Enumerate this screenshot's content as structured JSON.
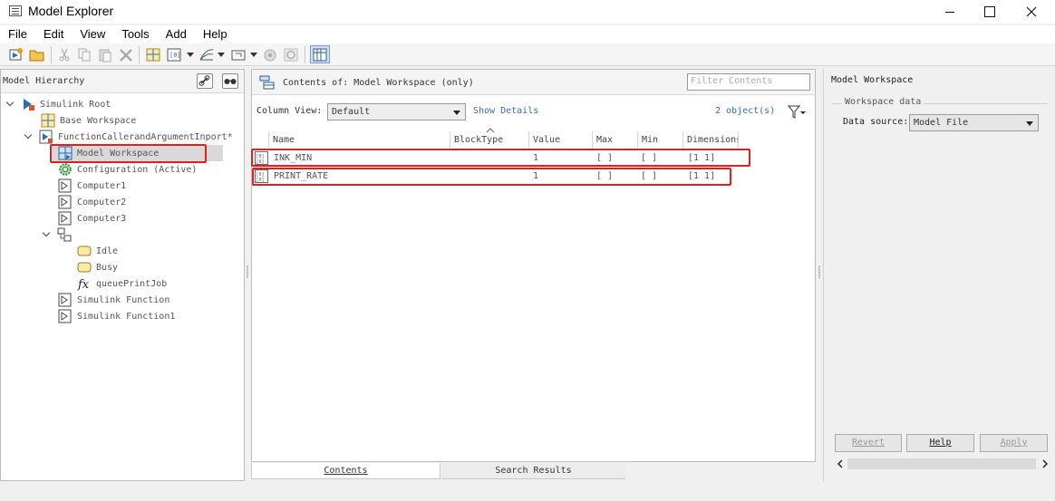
{
  "window": {
    "title": "Model Explorer"
  },
  "menu": [
    "File",
    "Edit",
    "View",
    "Tools",
    "Add",
    "Help"
  ],
  "toolbar": {
    "icons": [
      "new-model-icon",
      "open-icon",
      "cut-icon",
      "copy-icon",
      "paste-icon",
      "delete-icon",
      "grid-view-icon",
      "workspace-variable-icon",
      "signal-icon",
      "block-icon",
      "link-icon",
      "settings-icon",
      "columns-toggle-icon"
    ]
  },
  "hierarchy": {
    "title": "Model Hierarchy",
    "nodes": [
      {
        "label": "Simulink Root"
      },
      {
        "label": "Base Workspace"
      },
      {
        "label": "FunctionCallerandArgumentInport*"
      },
      {
        "label": "Model Workspace",
        "selected": true
      },
      {
        "label": "Configuration (Active)"
      },
      {
        "label": "Computer1"
      },
      {
        "label": "Computer2"
      },
      {
        "label": "Computer3"
      },
      {
        "label": ""
      },
      {
        "label": "Idle"
      },
      {
        "label": "Busy"
      },
      {
        "label": "queuePrintJob"
      },
      {
        "label": "Simulink Function"
      },
      {
        "label": "Simulink Function1"
      }
    ]
  },
  "contents": {
    "header": "Contents of: Model Workspace  (only)",
    "filter_placeholder": "Filter Contents",
    "column_view_label": "Column View:",
    "column_view_value": "Default",
    "show_details": "Show Details",
    "object_count": "2 object(s)",
    "columns": [
      "Name",
      "BlockType",
      "Value",
      "Max",
      "Min",
      "Dimensions"
    ],
    "rows": [
      {
        "name": "INK_MIN",
        "blocktype": "",
        "value": "1",
        "max": "[ ]",
        "min": "[ ]",
        "dimensions": "[1 1]"
      },
      {
        "name": "PRINT_RATE",
        "blocktype": "",
        "value": "1",
        "max": "[ ]",
        "min": "[ ]",
        "dimensions": "[1 1]"
      }
    ],
    "tabs": [
      "Contents",
      "Search Results"
    ]
  },
  "properties": {
    "title": "Model Workspace",
    "group": "Workspace data",
    "data_source_label": "Data source:",
    "data_source_value": "Model File",
    "buttons": {
      "revert": "Revert",
      "help": "Help",
      "apply": "Apply"
    }
  }
}
